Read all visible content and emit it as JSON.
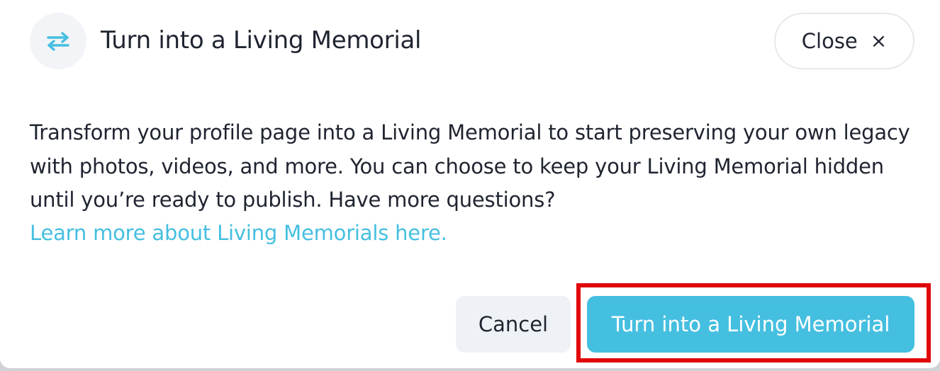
{
  "dialog": {
    "title": "Turn into a Living Memorial",
    "icon": "swap-arrows-icon",
    "close": {
      "label": "Close",
      "icon": "close-icon",
      "glyph": "×"
    },
    "body_text": "Transform your profile page into a Living Memorial to start preserving your own legacy with photos, videos, and more. You can choose to keep your Living Memorial hidden until you’re ready to publish. Have more questions?",
    "learn_more_link": "Learn more about Living Memorials here.",
    "actions": {
      "cancel_label": "Cancel",
      "primary_label": "Turn into a Living Memorial"
    }
  },
  "colors": {
    "accent": "#45bfe0",
    "text": "#1f2430",
    "highlight": "#e0060b",
    "icon_bg": "#f2f4f7",
    "cancel_bg": "#eef1f5"
  }
}
